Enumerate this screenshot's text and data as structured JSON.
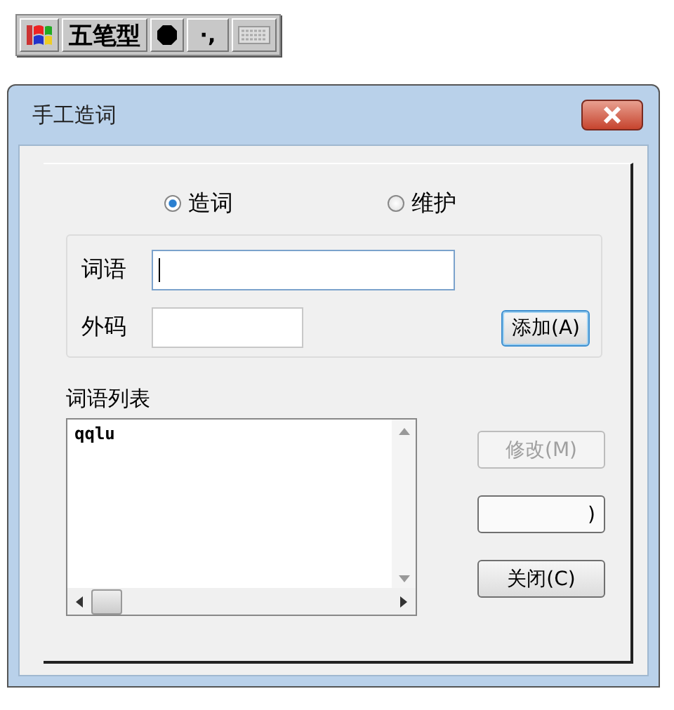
{
  "ime_toolbar": {
    "mode": "五笔型",
    "punctuation": "·,"
  },
  "window": {
    "title": "手工造词"
  },
  "modes": [
    {
      "label": "造词",
      "selected": true
    },
    {
      "label": "维护",
      "selected": false
    }
  ],
  "fields": [
    {
      "label": "词语",
      "focused": true
    },
    {
      "label": "外码",
      "focused": false
    }
  ],
  "add_button": {
    "label": "添加(A)"
  },
  "list": {
    "label": "词语列表",
    "items": [
      "qqlu"
    ]
  },
  "buttons": [
    {
      "label": "修改(M)",
      "disabled": true
    },
    {
      "label": ")",
      "disabled": false
    },
    {
      "label": "关闭(C)",
      "disabled": false
    }
  ]
}
